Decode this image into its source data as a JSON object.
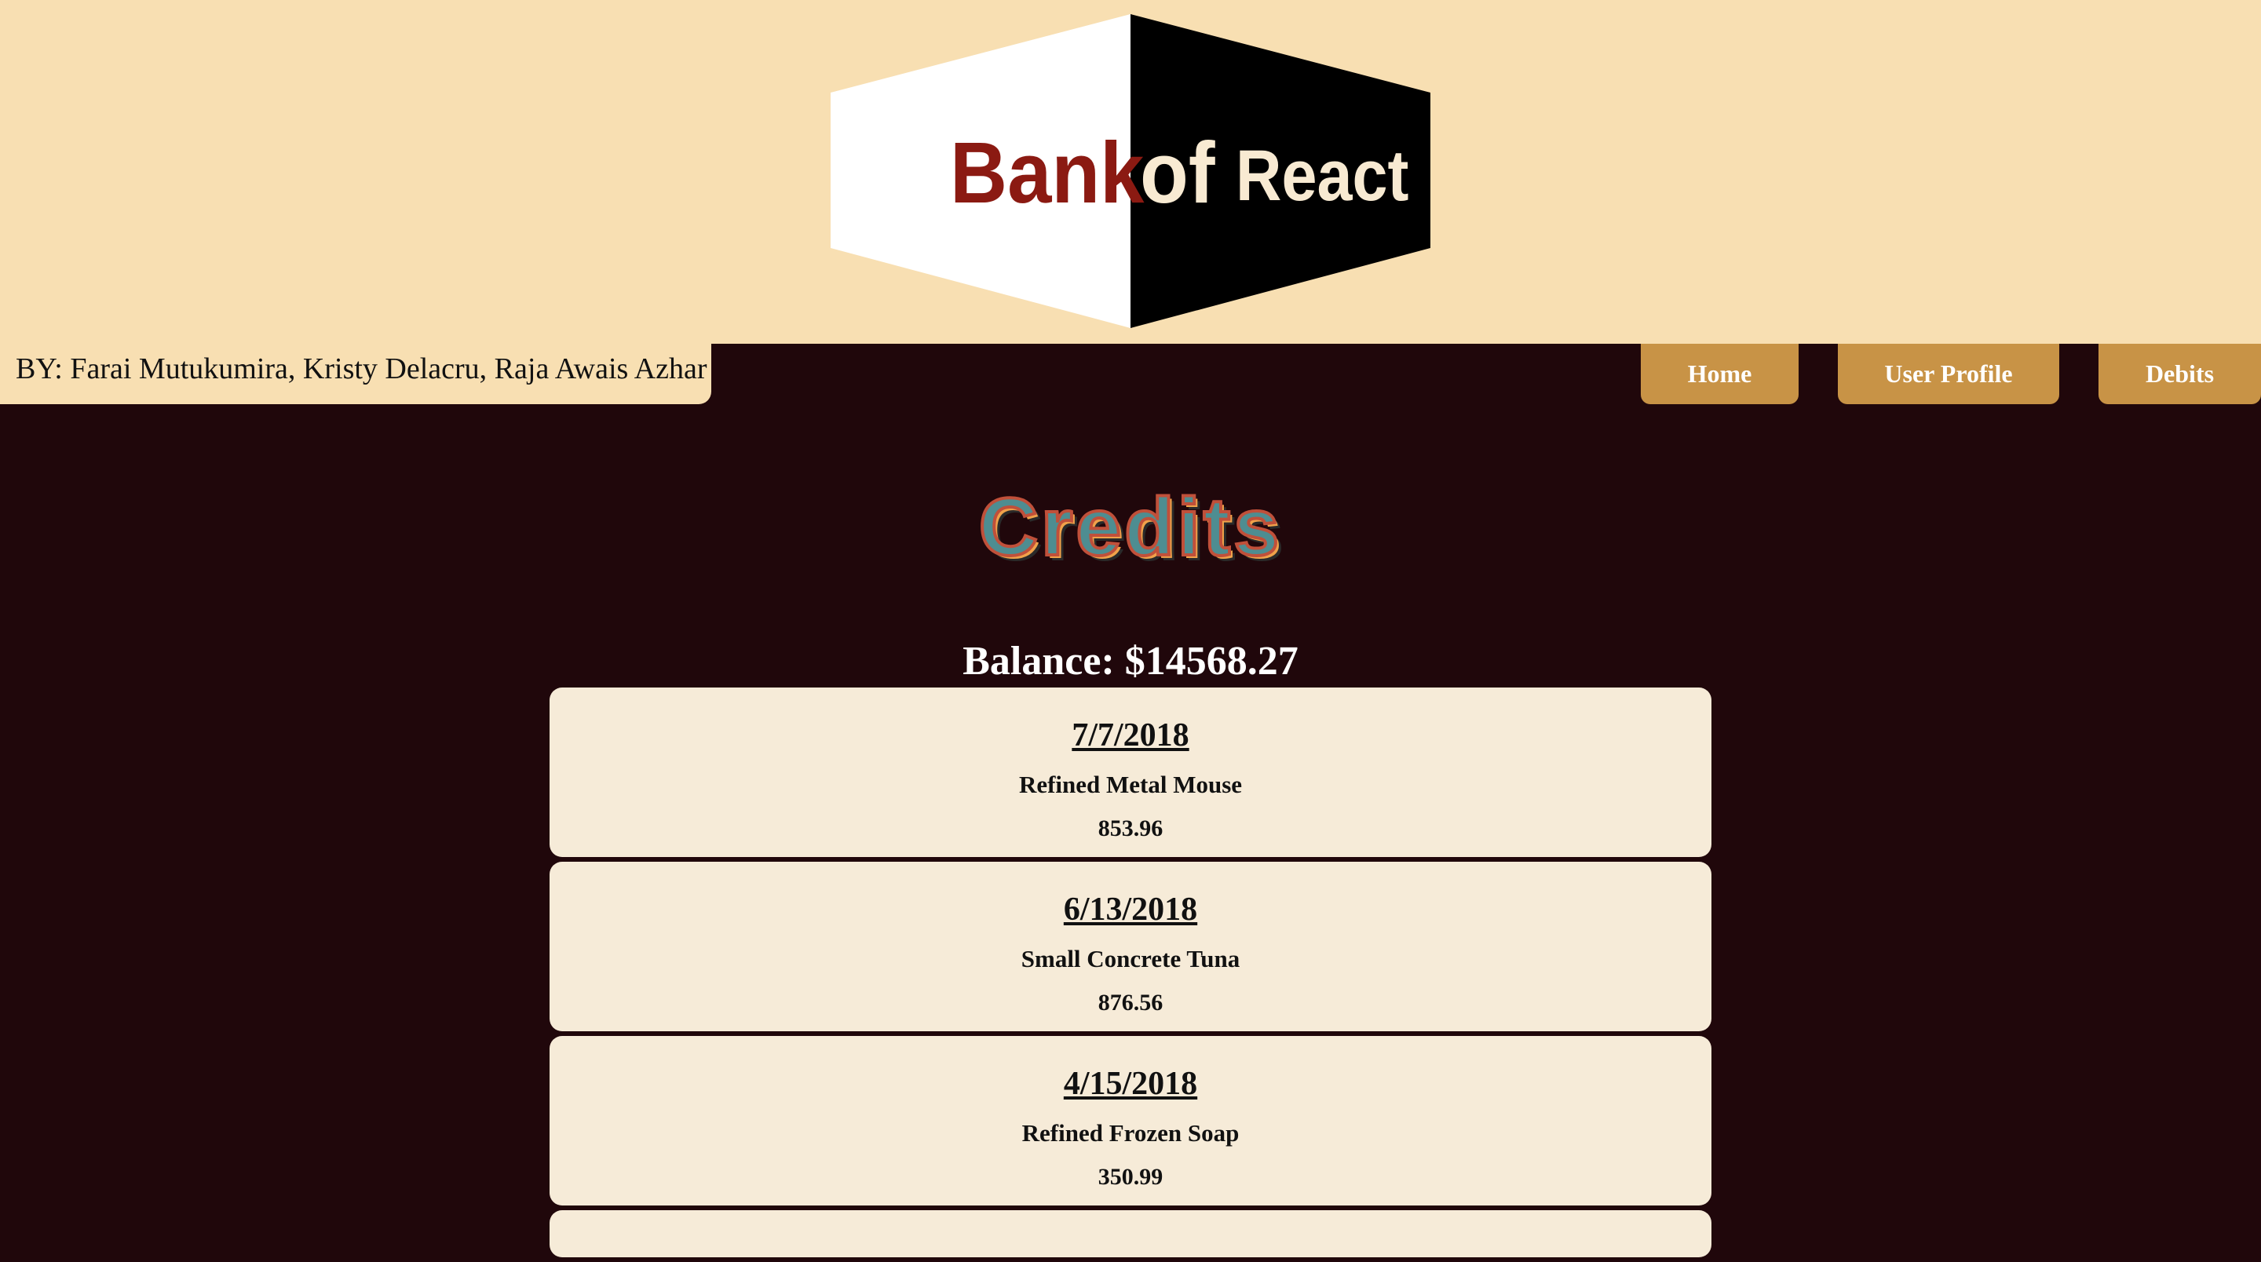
{
  "header": {
    "logo": {
      "word_1": "Bank",
      "word_2": "of",
      "word_3": "React"
    },
    "authors": "BY: Farai Mutukumira, Kristy Delacru, Raja Awais Azhar"
  },
  "nav": {
    "items": [
      {
        "label": "Home"
      },
      {
        "label": "User Profile"
      },
      {
        "label": "Debits"
      }
    ]
  },
  "main": {
    "title": "Credits",
    "balance": "Balance: $14568.27",
    "credits": [
      {
        "date": "7/7/2018",
        "description": "Refined Metal Mouse",
        "amount": "853.96"
      },
      {
        "date": "6/13/2018",
        "description": "Small Concrete Tuna",
        "amount": "876.56"
      },
      {
        "date": "4/15/2018",
        "description": "Refined Frozen Soap",
        "amount": "350.99"
      }
    ]
  },
  "colors": {
    "page_background": "#20070b",
    "header_background": "#f8dfb2",
    "nav_button": "#c89346",
    "card_background": "#f6ebd8",
    "logo_red": "#8b1a12",
    "title_teal": "#4e8d91"
  }
}
